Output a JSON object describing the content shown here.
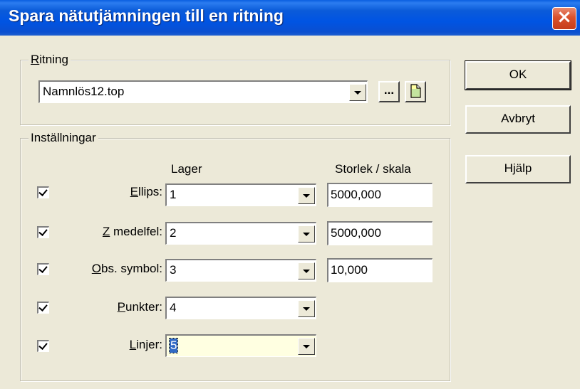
{
  "window": {
    "title": "Spara nätutjämningen till en ritning",
    "close_symbol": "×"
  },
  "ritning": {
    "legend_accel": "R",
    "legend_rest": "itning",
    "drawing_value": "Namnlös12.top",
    "browse_label": "...",
    "new_icon": "new-document-icon"
  },
  "installningar": {
    "legend": "Inställningar",
    "col_lager": "Lager",
    "col_storlek": "Storlek / skala",
    "rows": [
      {
        "accel": "E",
        "rest": "llips:",
        "checked": true,
        "layer": "1",
        "size": "5000,000"
      },
      {
        "accel": "Z",
        "rest": " medelfel:",
        "checked": true,
        "layer": "2",
        "size": "5000,000"
      },
      {
        "accel": "O",
        "rest": "bs. symbol:",
        "checked": true,
        "layer": "3",
        "size": "10,000"
      },
      {
        "accel": "P",
        "rest": "unkter:",
        "checked": true,
        "layer": "4",
        "size": null
      },
      {
        "accel": "L",
        "rest": "injer:",
        "checked": true,
        "layer": "5",
        "size": null
      }
    ]
  },
  "buttons": {
    "ok": "OK",
    "cancel": "Avbryt",
    "help": "Hjälp"
  },
  "colors": {
    "titlebar": "#0054e3",
    "dialog_bg": "#ece9d8",
    "close_bg": "#d9512c",
    "focused_field_bg": "#ffffe1"
  }
}
